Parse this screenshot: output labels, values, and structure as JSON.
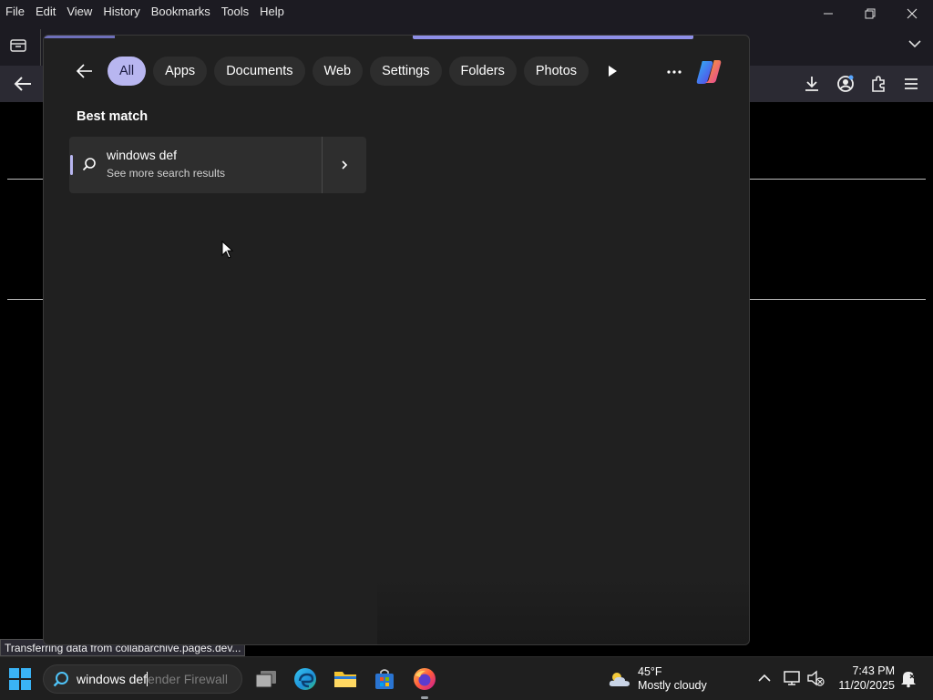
{
  "browser": {
    "menu": [
      "File",
      "Edit",
      "View",
      "History",
      "Bookmarks",
      "Tools",
      "Help"
    ],
    "status_text": "Transferring data from collabarchive.pages.dev..."
  },
  "search": {
    "filters": [
      {
        "label": "All",
        "active": true
      },
      {
        "label": "Apps",
        "active": false
      },
      {
        "label": "Documents",
        "active": false
      },
      {
        "label": "Web",
        "active": false
      },
      {
        "label": "Settings",
        "active": false
      },
      {
        "label": "Folders",
        "active": false
      },
      {
        "label": "Photos",
        "active": false
      }
    ],
    "section_title": "Best match",
    "result_title": "windows def",
    "result_subtitle": "See more search results",
    "query_typed": "windows def",
    "query_suggestion": "ender Firewall"
  },
  "taskbar": {
    "apps": [
      "task-view-icon",
      "edge-icon",
      "file-explorer-icon",
      "store-icon",
      "firefox-icon"
    ],
    "weather_temp": "45°F",
    "weather_desc": "Mostly cloudy",
    "time": "7:43 PM",
    "date": "11/20/2025"
  },
  "colors": {
    "accent": "#b8b6f0",
    "flyout_bg": "#202020",
    "taskbar_bg": "#1f1f1f"
  }
}
